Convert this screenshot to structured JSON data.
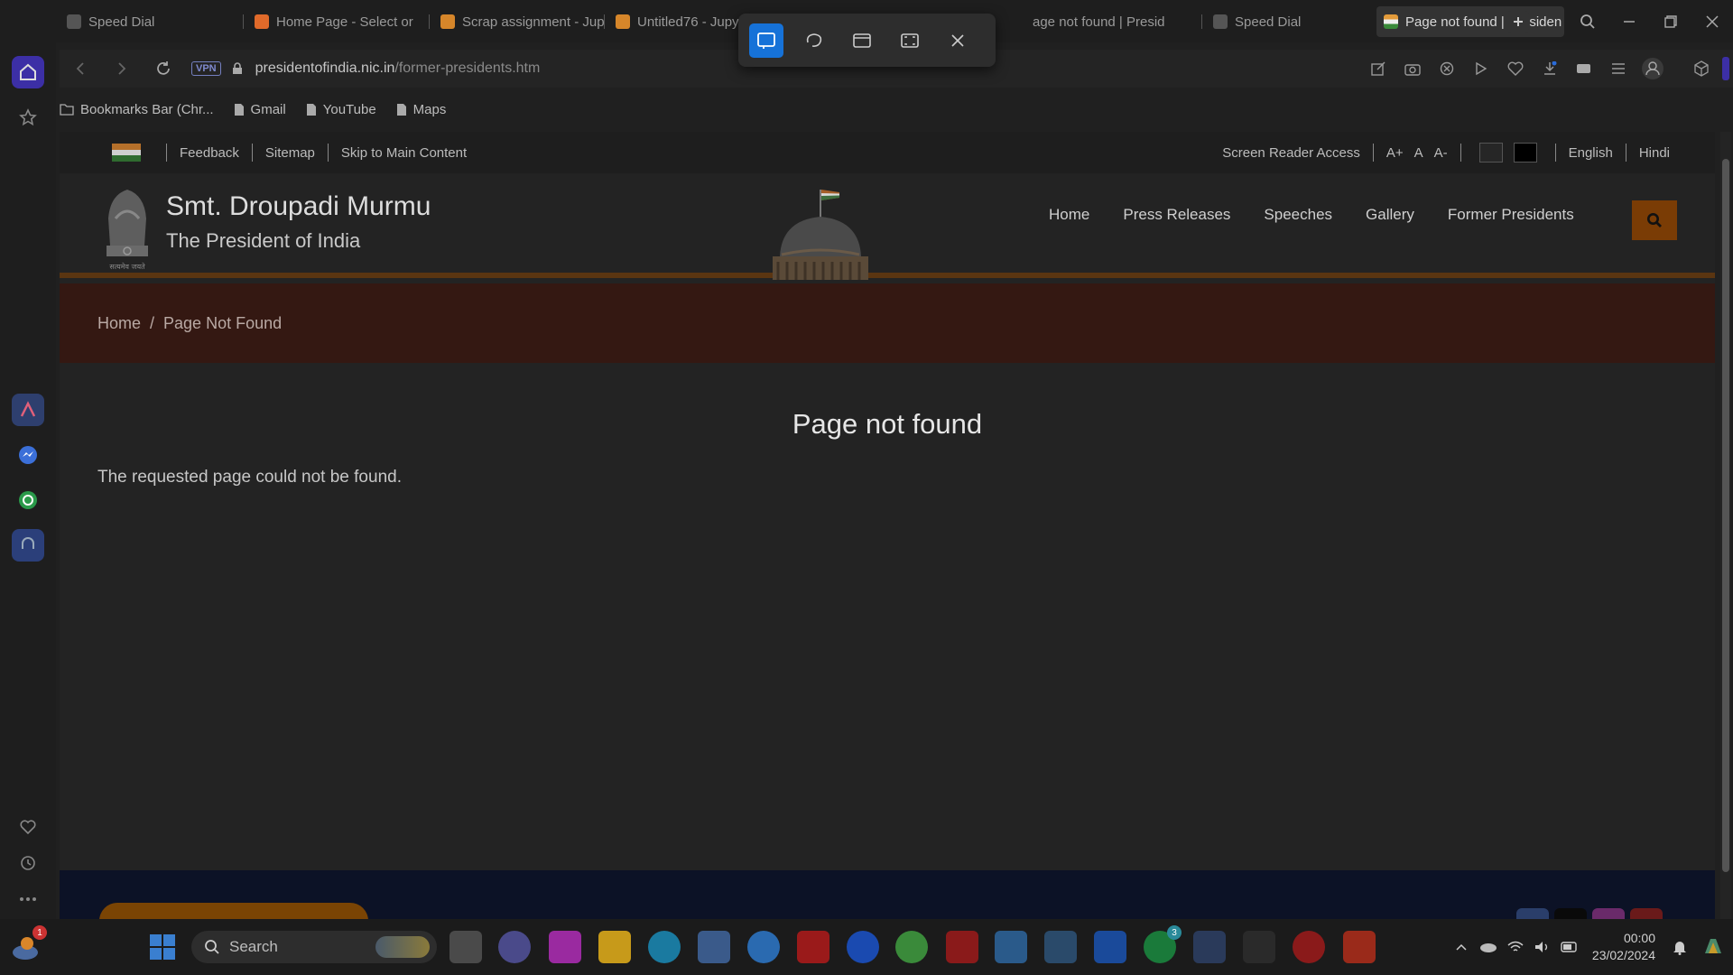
{
  "browser": {
    "tabs": [
      {
        "title": "Speed Dial",
        "favicon_color": "#7a7a7a"
      },
      {
        "title": "Home Page - Select or",
        "favicon_color": "#e06a2a"
      },
      {
        "title": "Scrap assignment - Jup",
        "favicon_color": "#d6862a"
      },
      {
        "title": "Untitled76 - Jupyt",
        "favicon_color": "#d6862a"
      },
      {
        "title": "age not found | Presid",
        "favicon_color": "#8a6a3a"
      },
      {
        "title": "Speed Dial",
        "favicon_color": "#7a7a7a"
      },
      {
        "title": "Page not found | Presiden",
        "favicon_color": "#e39b3a"
      }
    ],
    "url_domain": "presidentofindia.nic.in",
    "url_path": "/former-presidents.htm",
    "vpn_label": "VPN",
    "bookmarks": [
      {
        "label": "Bookmarks Bar (Chr..."
      },
      {
        "label": "Gmail"
      },
      {
        "label": "YouTube"
      },
      {
        "label": "Maps"
      }
    ]
  },
  "site": {
    "utility_left": [
      "Feedback",
      "Sitemap",
      "Skip to Main Content"
    ],
    "screen_reader": "Screen Reader Access",
    "font_controls": [
      "A+",
      "A",
      "A-"
    ],
    "languages": [
      "English",
      "Hindi"
    ],
    "name": "Smt. Droupadi Murmu",
    "subtitle": "The President of India",
    "emblem_caption": "सत्यमेव जयते",
    "nav": [
      "Home",
      "Press Releases",
      "Speeches",
      "Gallery",
      "Former Presidents"
    ],
    "breadcrumb": {
      "home": "Home",
      "separator": "/",
      "current": "Page Not Found"
    },
    "page_title": "Page not found",
    "page_message": "The requested page could not be found."
  },
  "taskbar": {
    "search_placeholder": "Search",
    "time": "00:00",
    "date": "23/02/2024",
    "weather_badge": "1",
    "whatsapp_badge": "3"
  },
  "colors": {
    "breadcrumb_band": "#341812",
    "search_button": "#7a3c05",
    "footer": "#0c1226",
    "snip_active": "#1672d8"
  }
}
